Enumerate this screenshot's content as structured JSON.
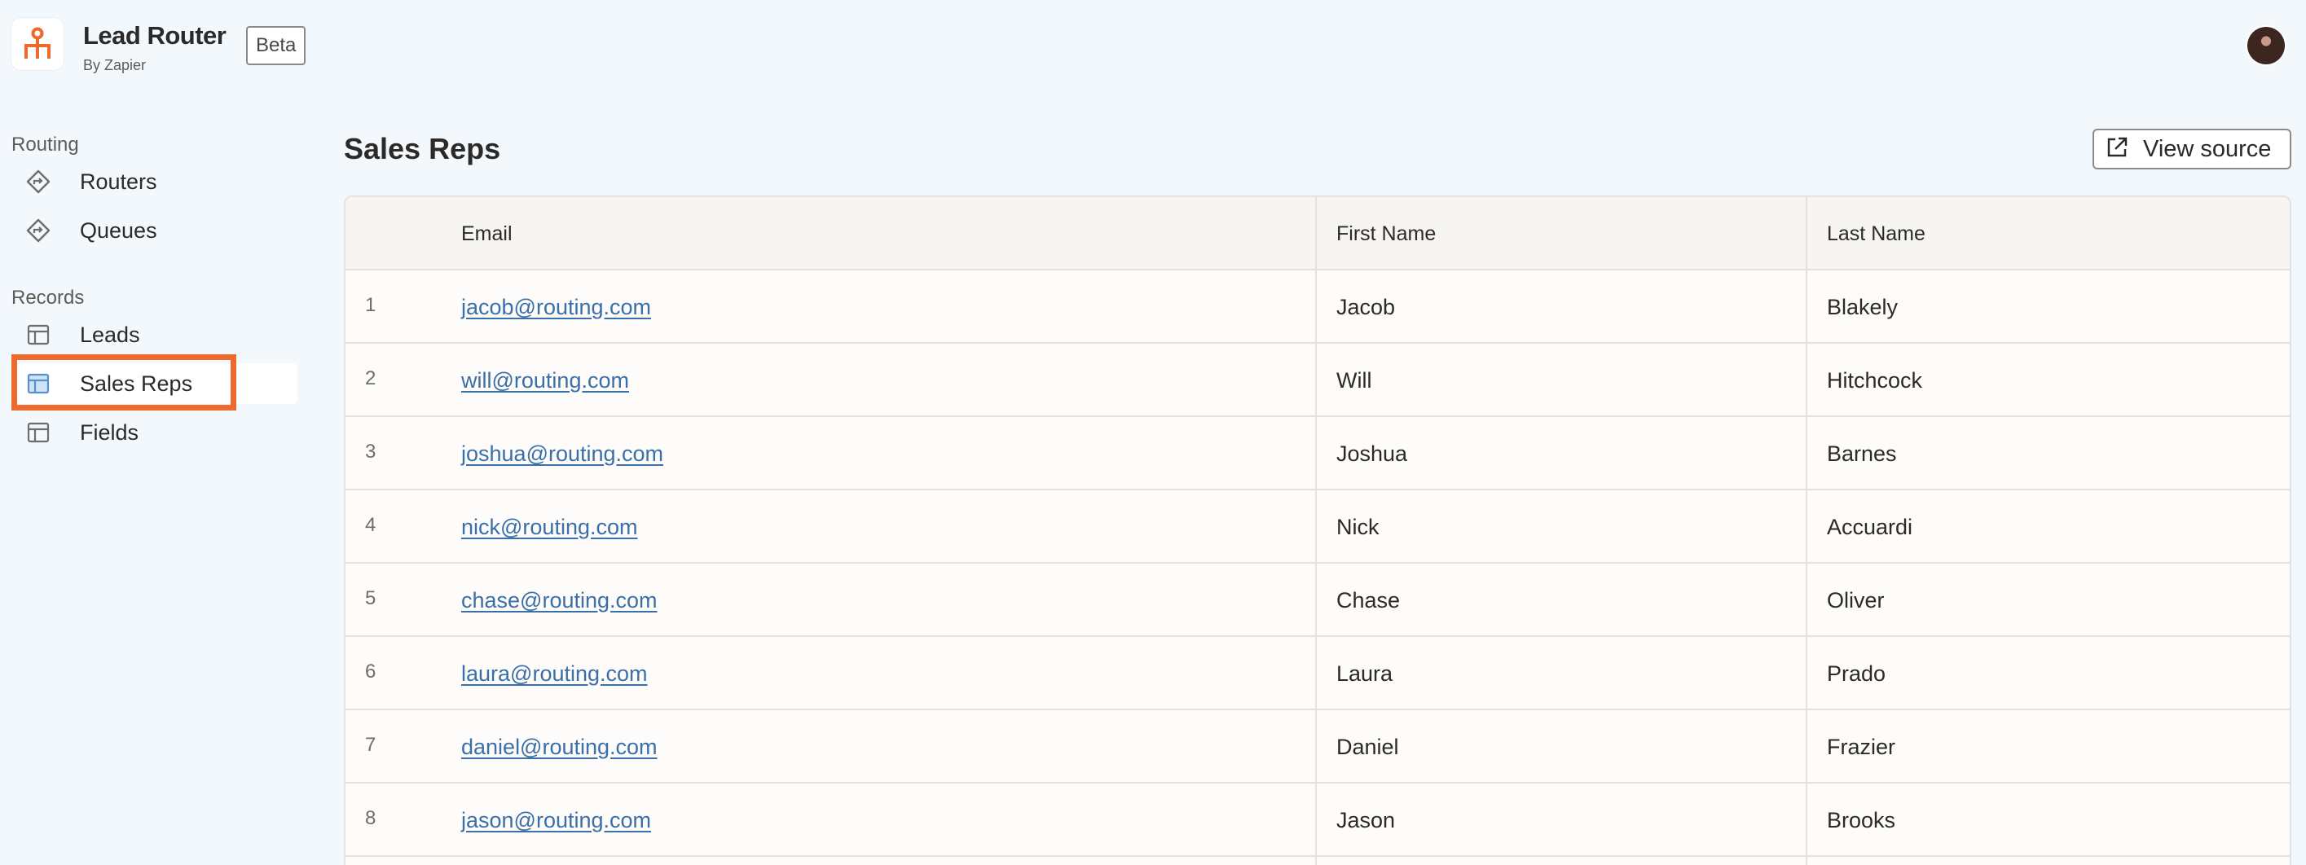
{
  "header": {
    "app_title": "Lead Router",
    "app_subtitle": "By Zapier",
    "badge": "Beta",
    "logo_icon": "router-logo-icon",
    "accent_color": "#ee6a2c"
  },
  "sidebar": {
    "sections": [
      {
        "label": "Routing",
        "items": [
          {
            "label": "Routers",
            "icon": "router-diamond-icon"
          },
          {
            "label": "Queues",
            "icon": "queue-diamond-icon"
          }
        ]
      },
      {
        "label": "Records",
        "items": [
          {
            "label": "Leads",
            "icon": "table-icon"
          },
          {
            "label": "Sales Reps",
            "icon": "table-icon",
            "active": true
          },
          {
            "label": "Fields",
            "icon": "table-icon"
          }
        ]
      }
    ]
  },
  "main": {
    "title": "Sales Reps",
    "view_source_label": "View source",
    "view_source_icon": "external-link-icon",
    "columns": [
      "Email",
      "First Name",
      "Last Name"
    ],
    "rows": [
      {
        "num": "1",
        "email": "jacob@routing.com",
        "first": "Jacob",
        "last": "Blakely"
      },
      {
        "num": "2",
        "email": "will@routing.com",
        "first": "Will",
        "last": "Hitchcock"
      },
      {
        "num": "3",
        "email": "joshua@routing.com",
        "first": "Joshua",
        "last": "Barnes"
      },
      {
        "num": "4",
        "email": "nick@routing.com",
        "first": "Nick",
        "last": "Accuardi"
      },
      {
        "num": "5",
        "email": "chase@routing.com",
        "first": "Chase",
        "last": "Oliver"
      },
      {
        "num": "6",
        "email": "laura@routing.com",
        "first": "Laura",
        "last": "Prado"
      },
      {
        "num": "7",
        "email": "daniel@routing.com",
        "first": "Daniel",
        "last": "Frazier"
      },
      {
        "num": "8",
        "email": "jason@routing.com",
        "first": "Jason",
        "last": "Brooks"
      }
    ]
  }
}
